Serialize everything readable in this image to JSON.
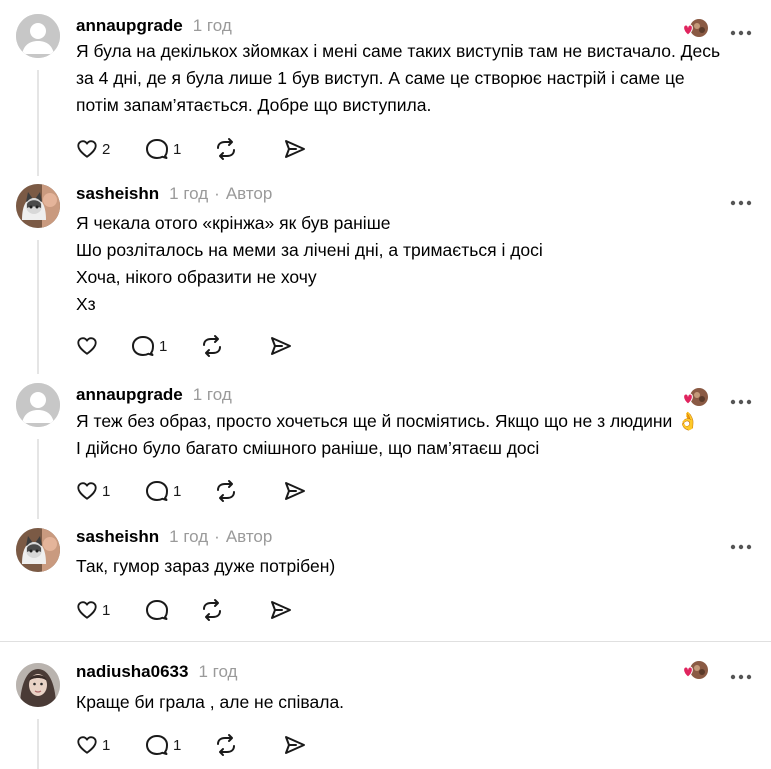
{
  "comments": [
    {
      "username": "annaupgrade",
      "time": "1 год",
      "author_label": "",
      "lines": [
        "Я була на декількох зйомках і мені саме таких виступів там не вистачало. Десь",
        "за 4 дні, де я була лише 1 був виступ. А саме це створює настрій і саме це",
        "потім запам’ятається. Добре що виступила."
      ],
      "likes": "2",
      "replies": "1",
      "avatar": "default-avatar-icon",
      "liked_by_author": true
    },
    {
      "username": "sasheishn",
      "time": "1 год",
      "author_label": "Автор",
      "lines": [
        "Я чекала отого «крінжа» як був раніше",
        "Шо розліталось на меми за лічені дні, а тримається і досі",
        "Хоча, нікого образити не хочу",
        "Хз"
      ],
      "likes": "",
      "replies": "1",
      "avatar": "cat-photo-avatar",
      "liked_by_author": false
    },
    {
      "username": "annaupgrade",
      "time": "1 год",
      "author_label": "",
      "lines": [
        "Я теж без образ, просто хочеться ще й посміятись. Якщо що не з людини 👌",
        "І дійсно було багато смішного раніше, що пам’ятаєш досі"
      ],
      "likes": "1",
      "replies": "1",
      "avatar": "default-avatar-icon",
      "liked_by_author": true
    },
    {
      "username": "sasheishn",
      "time": "1 год",
      "author_label": "Автор",
      "lines": [
        "Так, гумор зараз дуже потрібен)"
      ],
      "likes": "1",
      "replies": "",
      "avatar": "cat-photo-avatar",
      "liked_by_author": false
    },
    {
      "username": "nadiusha0633",
      "time": "1 год",
      "author_label": "",
      "lines": [
        "Краще би грала , але не співала."
      ],
      "likes": "1",
      "replies": "1",
      "avatar": "portrait-photo-avatar",
      "liked_by_author": true
    }
  ],
  "separator": "·",
  "colors": {
    "text": "#000000",
    "muted": "#9a9a9a",
    "thread_line": "#e5e5e5",
    "heart": "#e0245e"
  }
}
